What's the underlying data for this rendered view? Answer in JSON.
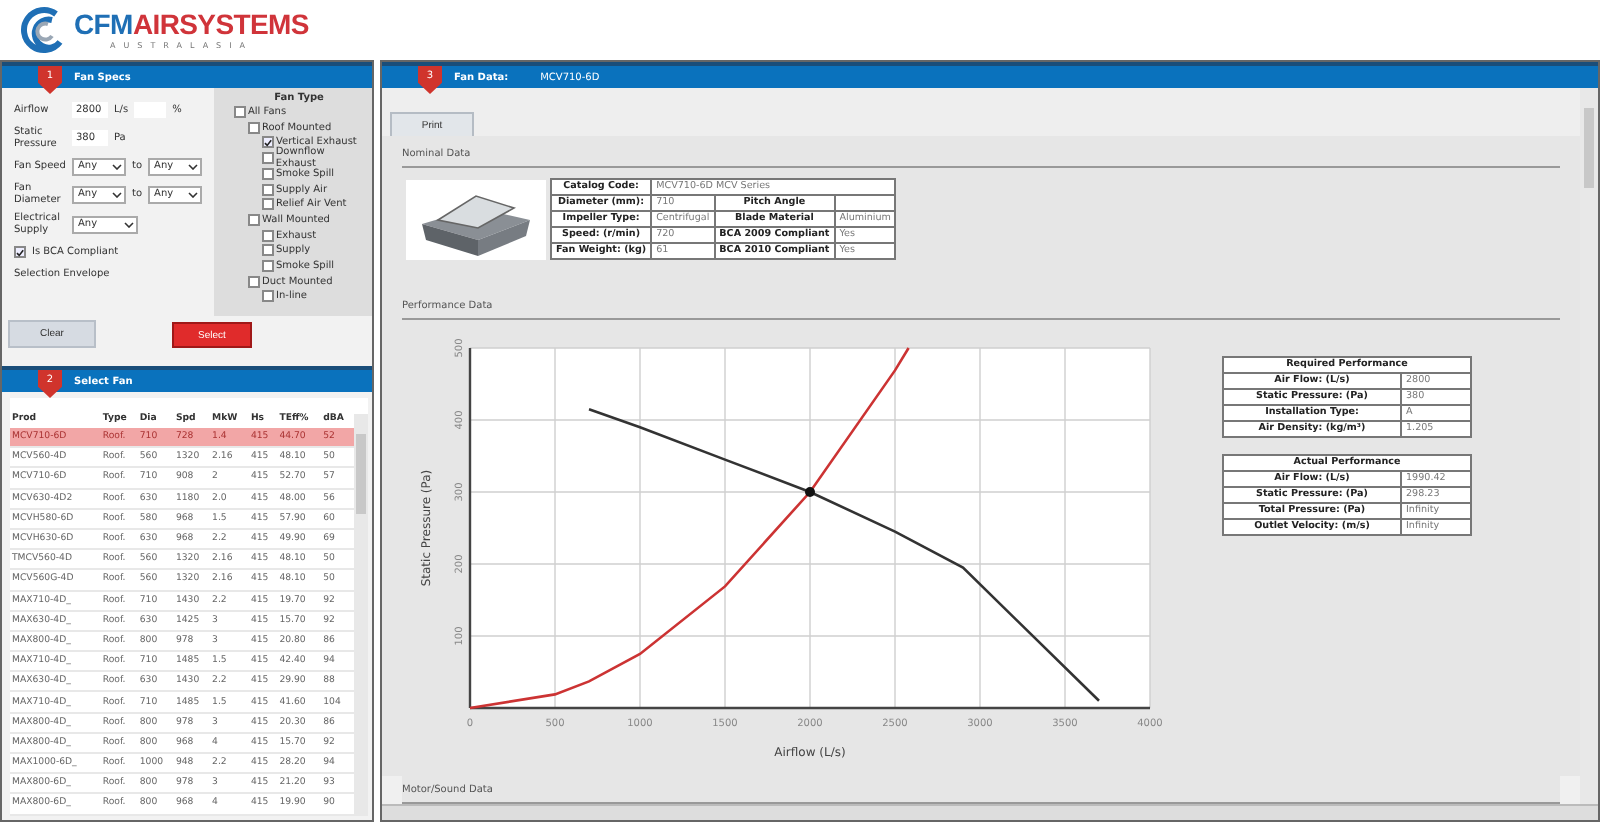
{
  "logo": {
    "brand_first": "CFM",
    "brand_second": "AIRSYSTEMS",
    "tagline": "AUSTRALASIA"
  },
  "fan_specs": {
    "step": "1",
    "title": "Fan Specs",
    "fields": [
      {
        "kind": "number",
        "label": "Airflow",
        "value": "2800",
        "unit": "L/s",
        "percent_unit": "%"
      },
      {
        "kind": "number",
        "label": "Static Pressure",
        "value": "380",
        "unit": "Pa"
      },
      {
        "kind": "range",
        "label": "Fan Speed",
        "from": "Any",
        "between": "to",
        "to": "Any"
      },
      {
        "kind": "range",
        "label": "Fan Diameter",
        "from": "Any",
        "between": "to",
        "to": "Any"
      },
      {
        "kind": "select",
        "label": "Electrical Supply",
        "value": "Any"
      }
    ],
    "bca": {
      "label": "Is BCA Compliant",
      "checked": true
    },
    "selection_envelope": "Selection Envelope",
    "fan_type": {
      "title": "Fan Type",
      "tree": [
        {
          "label": "All Fans",
          "checked": false,
          "children": [
            {
              "label": "Roof Mounted",
              "checked": false,
              "children": [
                {
                  "label": "Vertical Exhaust",
                  "checked": true
                },
                {
                  "label": "Downflow Exhaust",
                  "checked": false
                },
                {
                  "label": "Smoke Spill",
                  "checked": false
                },
                {
                  "label": "Supply Air",
                  "checked": false
                },
                {
                  "label": "Relief Air Vent",
                  "checked": false
                }
              ]
            },
            {
              "label": "Wall Mounted",
              "checked": false,
              "children": [
                {
                  "label": "Exhaust",
                  "checked": false
                },
                {
                  "label": "Supply",
                  "checked": false
                },
                {
                  "label": "Smoke Spill",
                  "checked": false
                }
              ]
            },
            {
              "label": "Duct Mounted",
              "checked": false,
              "children": [
                {
                  "label": "In-line",
                  "checked": false
                }
              ]
            }
          ]
        }
      ]
    },
    "clear": "Clear",
    "select": "Select"
  },
  "select_fan": {
    "step": "2",
    "title": "Select Fan",
    "columns": [
      "Prod",
      "Type",
      "Dia",
      "Spd",
      "MkW",
      "Hs",
      "TEff%",
      "dBA"
    ],
    "rows": [
      {
        "cells": [
          "MCV710-6D",
          "Roof.",
          "710",
          "728",
          "1.4",
          "415",
          "44.70",
          "52"
        ],
        "selected": true
      },
      {
        "cells": [
          "MCV560-4D",
          "Roof.",
          "560",
          "1320",
          "2.16",
          "415",
          "48.10",
          "50"
        ],
        "selected": false
      },
      {
        "cells": [
          "MCV710-6D",
          "Roof.",
          "710",
          "908",
          "2",
          "415",
          "52.70",
          "57"
        ],
        "selected": false
      },
      {
        "cells": [
          "MCV630-4D2",
          "Roof.",
          "630",
          "1180",
          "2.0",
          "415",
          "48.00",
          "56"
        ],
        "selected": false
      },
      {
        "cells": [
          "MCVH580-6D",
          "Roof.",
          "580",
          "968",
          "1.5",
          "415",
          "57.90",
          "60"
        ],
        "selected": false
      },
      {
        "cells": [
          "MCVH630-6D",
          "Roof.",
          "630",
          "968",
          "2.2",
          "415",
          "49.90",
          "69"
        ],
        "selected": false
      },
      {
        "cells": [
          "TMCV560-4D",
          "Roof.",
          "560",
          "1320",
          "2.16",
          "415",
          "48.10",
          "50"
        ],
        "selected": false
      },
      {
        "cells": [
          "MCV560G-4D",
          "Roof.",
          "560",
          "1320",
          "2.16",
          "415",
          "48.10",
          "50"
        ],
        "selected": false
      },
      {
        "cells": [
          "MAX710-4D_",
          "Roof.",
          "710",
          "1430",
          "2.2",
          "415",
          "19.70",
          "92"
        ],
        "selected": false
      },
      {
        "cells": [
          "MAX630-4D_",
          "Roof.",
          "630",
          "1425",
          "3",
          "415",
          "15.70",
          "92"
        ],
        "selected": false
      },
      {
        "cells": [
          "MAX800-4D_",
          "Roof.",
          "800",
          "978",
          "3",
          "415",
          "20.80",
          "86"
        ],
        "selected": false
      },
      {
        "cells": [
          "MAX710-4D_",
          "Roof.",
          "710",
          "1485",
          "1.5",
          "415",
          "42.40",
          "94"
        ],
        "selected": false
      },
      {
        "cells": [
          "MAX630-4D_",
          "Roof.",
          "630",
          "1430",
          "2.2",
          "415",
          "29.90",
          "88"
        ],
        "selected": false
      },
      {
        "cells": [
          "MAX710-4D_",
          "Roof.",
          "710",
          "1485",
          "1.5",
          "415",
          "41.60",
          "104"
        ],
        "selected": false
      },
      {
        "cells": [
          "MAX800-4D_",
          "Roof.",
          "800",
          "978",
          "3",
          "415",
          "20.30",
          "86"
        ],
        "selected": false
      },
      {
        "cells": [
          "MAX800-4D_",
          "Roof.",
          "800",
          "968",
          "4",
          "415",
          "15.70",
          "92"
        ],
        "selected": false
      },
      {
        "cells": [
          "MAX1000-6D_",
          "Roof.",
          "1000",
          "948",
          "2.2",
          "415",
          "28.20",
          "94"
        ],
        "selected": false
      },
      {
        "cells": [
          "MAX800-6D_",
          "Roof.",
          "800",
          "978",
          "3",
          "415",
          "21.20",
          "93"
        ],
        "selected": false
      },
      {
        "cells": [
          "MAX800-6D_",
          "Roof.",
          "800",
          "968",
          "4",
          "415",
          "19.90",
          "90"
        ],
        "selected": false
      }
    ]
  },
  "fan_data": {
    "step": "3",
    "title": "Fan Data:",
    "model": "MCV710-6D",
    "print": "Print",
    "nominal": {
      "heading": "Nominal Data",
      "rows": [
        {
          "label_1": "Catalog Code:",
          "value_1": "MCV710-6D MCV Series"
        },
        {
          "label_1": "Diameter (mm):",
          "value_1": "710",
          "label_2": "Pitch Angle"
        },
        {
          "label_1": "Impeller Type:",
          "value_1": "Centrifugal",
          "label_2": "Blade Material",
          "value_2": "Aluminium"
        },
        {
          "label_1": "Speed: (r/min)",
          "value_1": "720",
          "label_2": "BCA 2009 Compliant",
          "value_2": "Yes"
        },
        {
          "label_1": "Fan Weight: (kg)",
          "value_1": "61",
          "label_2": "BCA 2010 Compliant",
          "value_2": "Yes"
        }
      ]
    },
    "performance": {
      "heading": "Performance Data",
      "chart_data": {
        "type": "line",
        "xlabel": "Airflow (L/s)",
        "ylabel": "Static Pressure (Pa)",
        "x": [
          0,
          500,
          700,
          1000,
          1500,
          2000,
          2500,
          2580,
          2900,
          3700
        ],
        "series": [
          {
            "color": "#333333",
            "values": [
              null,
              null,
              415,
              390,
              345,
              300,
              245,
              null,
              195,
              10
            ]
          },
          {
            "color": "#cc3333",
            "values": [
              0,
              19,
              37,
              75,
              169,
              300,
              469,
              500,
              null,
              null
            ]
          }
        ],
        "xlim": [
          0,
          4000
        ],
        "ylim": [
          0,
          500
        ],
        "xticks": [
          0,
          500,
          1000,
          1500,
          2000,
          2500,
          3000,
          3500,
          4000
        ],
        "yticks": [
          100,
          200,
          300,
          400,
          500
        ],
        "grid": true
      },
      "required": {
        "title": "Required Performance",
        "rows": [
          {
            "label": "Air Flow: (L/s)",
            "value": "2800"
          },
          {
            "label": "Static Pressure: (Pa)",
            "value": "380"
          },
          {
            "label": "Installation Type:",
            "value": "A"
          },
          {
            "label": "Air Density: (kg/m³)",
            "value": "1.205"
          }
        ]
      },
      "actual": {
        "title": "Actual Performance",
        "rows": [
          {
            "label": "Air Flow: (L/s)",
            "value": "1990.42"
          },
          {
            "label": "Static Pressure: (Pa)",
            "value": "298.23"
          },
          {
            "label": "Total Pressure: (Pa)",
            "value": "Infinity"
          },
          {
            "label": "Outlet Velocity: (m/s)",
            "value": "Infinity"
          }
        ]
      }
    },
    "next_heading": "Motor/Sound Data"
  }
}
